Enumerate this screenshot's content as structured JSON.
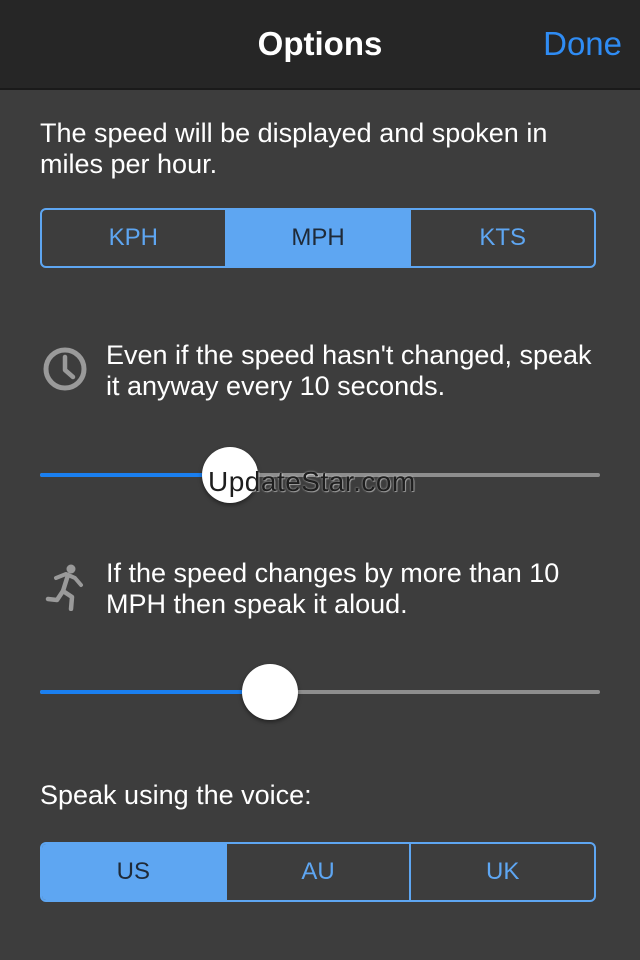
{
  "navbar": {
    "title": "Options",
    "done_label": "Done"
  },
  "units": {
    "description": "The speed will be displayed and spoken in miles per hour.",
    "options": [
      "KPH",
      "MPH",
      "KTS"
    ],
    "selected": "MPH"
  },
  "interval": {
    "icon": "clock-icon",
    "description": "Even if the speed hasn't changed, speak it anyway every 10 seconds.",
    "slider_fraction": 0.34
  },
  "change": {
    "icon": "running-person-icon",
    "description": "If the speed changes by more than 10 MPH then speak it aloud.",
    "slider_fraction": 0.41
  },
  "voice": {
    "label": "Speak using the voice:",
    "options": [
      "US",
      "AU",
      "UK"
    ],
    "selected": "US"
  },
  "watermark": "UpdateStar.com",
  "colors": {
    "accent": "#2f8cf4",
    "segment": "#5ea6f2",
    "background": "#3d3d3d",
    "navbar": "#262626"
  }
}
